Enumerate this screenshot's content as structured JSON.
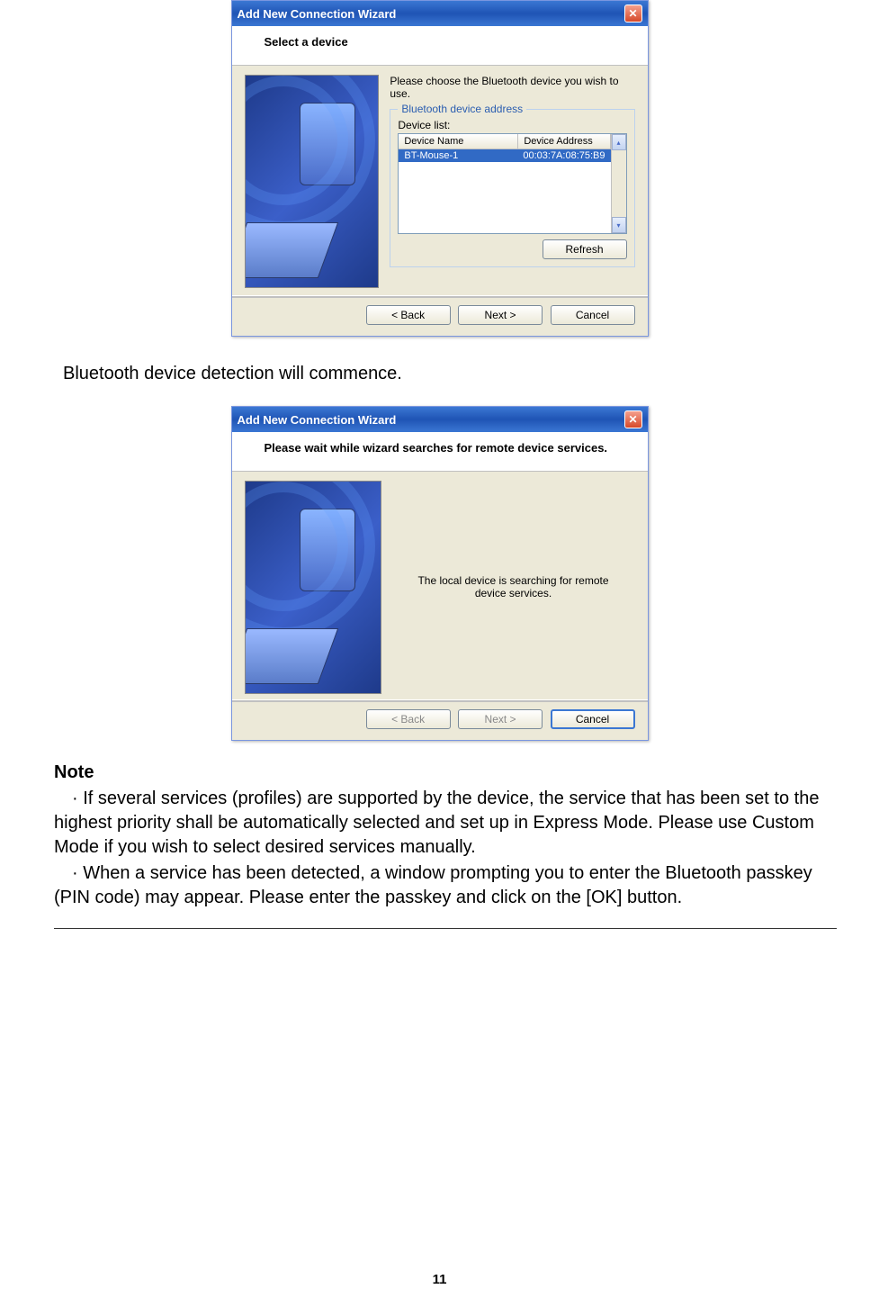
{
  "dialog1": {
    "title": "Add New Connection Wizard",
    "header": "Select a device",
    "instruction": "Please choose the Bluetooth device you wish to use.",
    "fieldset_legend": "Bluetooth device address",
    "device_list_label": "Device list:",
    "columns": {
      "name": "Device Name",
      "address": "Device Address"
    },
    "row": {
      "name": "BT-Mouse-1",
      "address": "00:03:7A:08:75:B9"
    },
    "refresh": "Refresh",
    "back": "< Back",
    "next": "Next >",
    "cancel": "Cancel"
  },
  "between_text": "Bluetooth device detection will commence.",
  "dialog2": {
    "title": "Add New Connection Wizard",
    "header": "Please wait while wizard searches for remote device services.",
    "message": "The local device is searching for remote device services.",
    "back": "< Back",
    "next": "Next >",
    "cancel": "Cancel"
  },
  "note": {
    "title": "Note",
    "p1": "If several services (profiles) are supported by the device, the service that has been set to the highest priority shall be automatically selected and set up in Express Mode. Please use Custom Mode if you wish to select desired services manually.",
    "p2": "When a service has been detected, a window prompting you to enter the Bluetooth passkey (PIN code) may appear. Please enter the passkey and click on the [OK] button."
  },
  "page_number": "11",
  "bullet_dot": "·"
}
